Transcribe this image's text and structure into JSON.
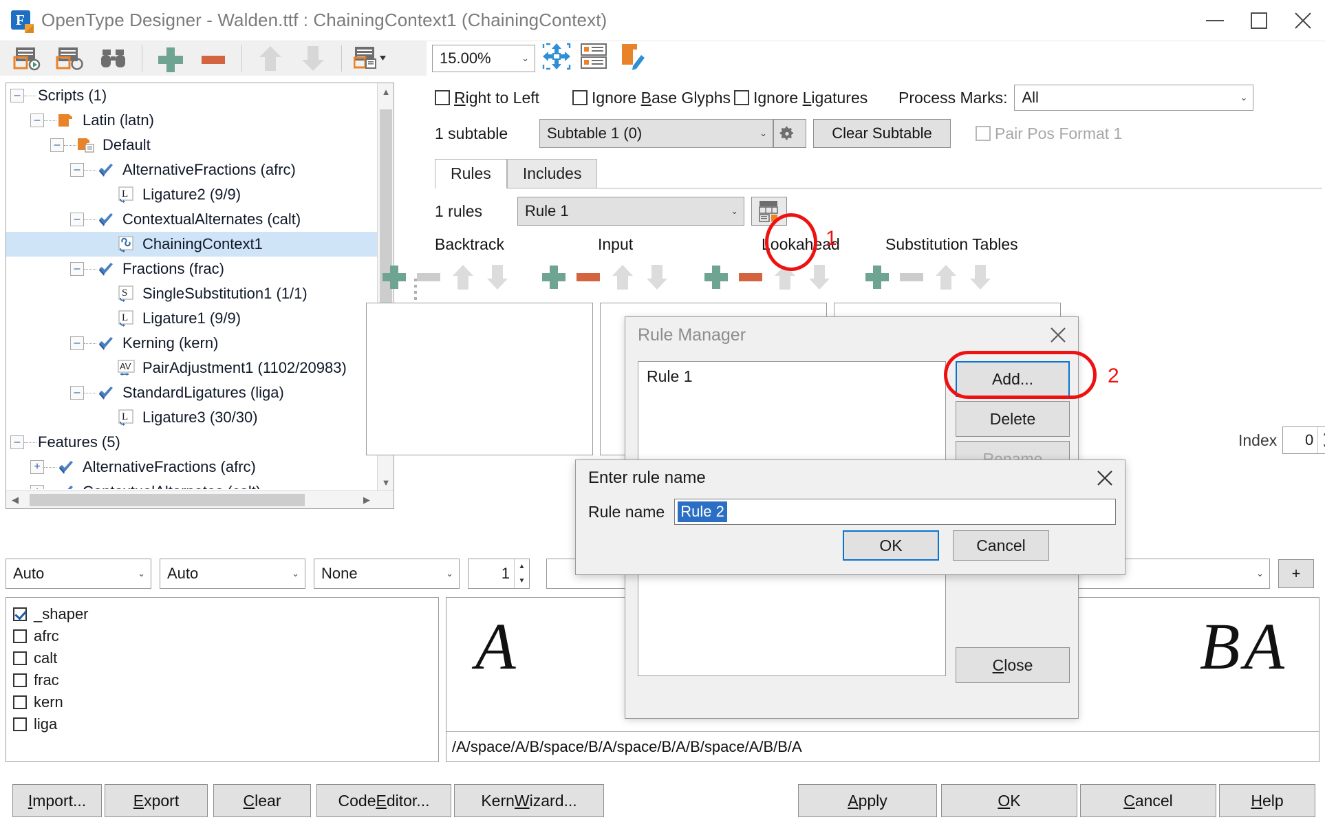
{
  "window": {
    "title": "OpenType Designer - Walden.ttf : ChainingContext1 (ChainingContext)",
    "minimize_label": "minimize-icon",
    "maximize_label": "maximize-icon",
    "close_label": "close-icon"
  },
  "toolbar": {
    "items": [
      {
        "name": "new-lookup-icon",
        "glyph": "new-lookup"
      },
      {
        "name": "find-lookup-icon",
        "glyph": "find-lookup"
      },
      {
        "name": "binoculars-icon",
        "glyph": "binoculars"
      },
      {
        "name": "add-icon",
        "glyph": "plus"
      },
      {
        "name": "remove-icon",
        "glyph": "minus"
      },
      {
        "name": "move-up-icon",
        "glyph": "arrow-up"
      },
      {
        "name": "move-down-icon",
        "glyph": "arrow-down"
      },
      {
        "name": "table-view-icon",
        "glyph": "table-dropdown"
      },
      {
        "name": "settings-icon",
        "glyph": "gears"
      }
    ]
  },
  "tree": {
    "nodes": [
      {
        "label": "Scripts (1)",
        "depth": 0,
        "expander": "minus",
        "icon": "none"
      },
      {
        "label": "Latin (latn)",
        "depth": 1,
        "expander": "minus",
        "icon": "script"
      },
      {
        "label": "Default",
        "depth": 2,
        "expander": "minus",
        "icon": "langsys"
      },
      {
        "label": "AlternativeFractions (afrc)",
        "depth": 3,
        "expander": "minus",
        "icon": "feature"
      },
      {
        "label": "Ligature2 (9/9)",
        "depth": 4,
        "expander": "none",
        "icon": "lookup-L"
      },
      {
        "label": "ContextualAlternates (calt)",
        "depth": 3,
        "expander": "minus",
        "icon": "feature"
      },
      {
        "label": "ChainingContext1",
        "depth": 4,
        "expander": "none",
        "icon": "lookup-chain",
        "selected": true
      },
      {
        "label": "Fractions (frac)",
        "depth": 3,
        "expander": "minus",
        "icon": "feature"
      },
      {
        "label": "SingleSubstitution1 (1/1)",
        "depth": 4,
        "expander": "none",
        "icon": "lookup-S"
      },
      {
        "label": "Ligature1 (9/9)",
        "depth": 4,
        "expander": "none",
        "icon": "lookup-L"
      },
      {
        "label": "Kerning (kern)",
        "depth": 3,
        "expander": "minus",
        "icon": "feature"
      },
      {
        "label": "PairAdjustment1 (1102/20983)",
        "depth": 4,
        "expander": "none",
        "icon": "lookup-AV"
      },
      {
        "label": "StandardLigatures (liga)",
        "depth": 3,
        "expander": "minus",
        "icon": "feature"
      },
      {
        "label": "Ligature3 (30/30)",
        "depth": 4,
        "expander": "none",
        "icon": "lookup-L"
      },
      {
        "label": "Features (5)",
        "depth": 0,
        "expander": "minus",
        "icon": "none"
      },
      {
        "label": "AlternativeFractions (afrc)",
        "depth": 1,
        "expander": "plus",
        "icon": "feature"
      },
      {
        "label": "ContextualAlternates (calt)",
        "depth": 1,
        "expander": "plus",
        "icon": "feature"
      }
    ]
  },
  "zoombar": {
    "zoom_value": "15.00%",
    "icons": [
      {
        "name": "fit-to-window-icon"
      },
      {
        "name": "glyph-grid-icon"
      },
      {
        "name": "edit-glyph-icon"
      }
    ]
  },
  "options": {
    "right_to_left": {
      "label_pre": "",
      "label_accel": "R",
      "label_post": "ight to Left",
      "checked": false
    },
    "ignore_base_glyphs": {
      "label_pre": "Ignore ",
      "label_accel": "B",
      "label_post": "ase Glyphs",
      "checked": false
    },
    "ignore_ligatures": {
      "label_pre": "Ignore ",
      "label_accel": "L",
      "label_post": "igatures",
      "checked": false
    },
    "process_marks_label": "Process Marks:",
    "process_marks_value": "All"
  },
  "subtable": {
    "count_label": "1 subtable",
    "selected": "Subtable 1 (0)",
    "settings_icon": "gears-icon",
    "clear_label": "Clear Subtable",
    "pair_pos_label": "Pair Pos Format 1",
    "pair_pos_checked": false
  },
  "tabs": [
    {
      "label": "Rules",
      "active": true
    },
    {
      "label": "Includes",
      "active": false
    }
  ],
  "rules": {
    "count_label": "1 rules",
    "selected": "Rule 1",
    "manager_icon": "rule-manager-icon",
    "columns": [
      "Backtrack",
      "Input",
      "Lookahead",
      "Substitution Tables"
    ],
    "index_label": "Index",
    "index_value": "0"
  },
  "bottom_controls": {
    "combo1": "Auto",
    "combo2": "Auto",
    "combo3": "None",
    "spinner": "1",
    "wide_combo": "",
    "plus_label": "+"
  },
  "features_list": [
    {
      "label": "_shaper",
      "checked": true
    },
    {
      "label": "afrc",
      "checked": false
    },
    {
      "label": "calt",
      "checked": false
    },
    {
      "label": "frac",
      "checked": false
    },
    {
      "label": "kern",
      "checked": false
    },
    {
      "label": "liga",
      "checked": false
    }
  ],
  "preview": {
    "left_glyphs": "A",
    "right_glyphs": "BA",
    "glyph_string": "/A/space/A/B/space/B/A/space/B/A/B/space/A/B/B/A"
  },
  "footer_buttons": [
    {
      "label_pre": "",
      "accel": "I",
      "label_post": "mport...",
      "name": "import-button"
    },
    {
      "label_pre": "",
      "accel": "E",
      "label_post": "xport",
      "name": "export-button"
    },
    {
      "label_pre": "",
      "accel": "C",
      "label_post": "lear",
      "name": "clear-button"
    },
    {
      "label_pre": "Code ",
      "accel": "E",
      "label_post": "ditor...",
      "name": "code-editor-button"
    },
    {
      "label_pre": "Kern ",
      "accel": "W",
      "label_post": "izard...",
      "name": "kern-wizard-button"
    },
    {
      "label_pre": "",
      "accel": "A",
      "label_post": "pply",
      "name": "apply-button"
    },
    {
      "label_pre": "",
      "accel": "O",
      "label_post": "K",
      "name": "ok-button"
    },
    {
      "label_pre": "",
      "accel": "C",
      "label_post": "ancel",
      "name": "cancel-button"
    },
    {
      "label_pre": "",
      "accel": "H",
      "label_post": "elp",
      "name": "help-button"
    }
  ],
  "rule_manager": {
    "title": "Rule Manager",
    "list_items": [
      "Rule 1"
    ],
    "add_label": "Add...",
    "delete_label": "Delete",
    "rename_label": "Rename",
    "close_label_pre": "",
    "close_accel": "C",
    "close_label_post": "lose"
  },
  "enter_rule_name": {
    "title": "Enter rule name",
    "field_label": "Rule name",
    "field_value": "Rule 2",
    "ok_label": "OK",
    "cancel_label": "Cancel"
  },
  "annotations": [
    {
      "number": "1",
      "target": "rule-manager-icon"
    },
    {
      "number": "2",
      "target": "add-button"
    }
  ],
  "colors": {
    "accent_blue": "#1e6fc4",
    "selection_blue": "#cfe4f7",
    "green_plus": "#6fa392",
    "red_minus": "#d4633f",
    "annotation_red": "#ee1111",
    "orange": "#e8832a"
  }
}
